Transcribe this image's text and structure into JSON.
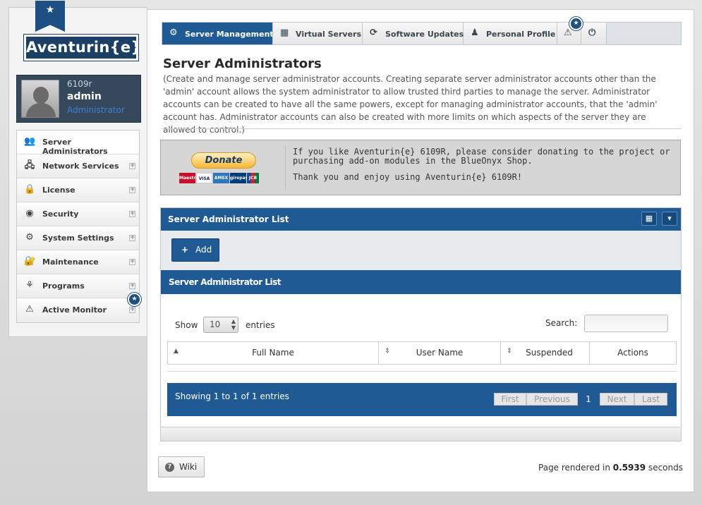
{
  "brand": {
    "name": "Aventurin{e}"
  },
  "user": {
    "host": "6109r",
    "name": "admin",
    "role": "Administrator"
  },
  "sidebar": {
    "items": [
      {
        "label": "Server Administrators",
        "icon": "users-icon",
        "glyph": "👥"
      },
      {
        "label": "Network Services",
        "icon": "network-icon",
        "glyph": "🖧"
      },
      {
        "label": "License",
        "icon": "lock-icon",
        "glyph": "🔒"
      },
      {
        "label": "Security",
        "icon": "eye-icon",
        "glyph": "◉"
      },
      {
        "label": "System Settings",
        "icon": "gear-icon",
        "glyph": "⚙"
      },
      {
        "label": "Maintenance",
        "icon": "wrench-lock-icon",
        "glyph": "🔐"
      },
      {
        "label": "Programs",
        "icon": "robot-icon",
        "glyph": "⚘"
      },
      {
        "label": "Active Monitor",
        "icon": "warning-icon",
        "glyph": "⚠"
      }
    ]
  },
  "tabs": [
    {
      "label": "Server Management",
      "icon": "gear-icon"
    },
    {
      "label": "Virtual Servers",
      "icon": "grid-icon"
    },
    {
      "label": "Software Updates",
      "icon": "refresh-icon"
    },
    {
      "label": "Personal Profile",
      "icon": "person-icon"
    }
  ],
  "page": {
    "title": "Server Administrators",
    "description": "(Create and manage server administrator accounts. Creating separate server administrator accounts other than the 'admin' account allows the system administrator to allow trusted third parties to manage the server. Administrator accounts can be created to have all the same powers, except for managing administrator accounts, that the 'admin' account has. Administrator accounts can also be created with more limits on which aspects of the server they are allowed to control.)"
  },
  "donate": {
    "button": "Donate",
    "cards": [
      "Maestro",
      "VISA",
      "AMEX",
      "giropay",
      "JCB"
    ],
    "text1": "If you like Aventurin{e} 6109R, please consider donating to the project or purchasing add-on modules in the BlueOnyx Shop.",
    "text2": "Thank you and enjoy using Aventurin{e} 6109R!"
  },
  "list": {
    "title": "Server Administrator List",
    "add_label": "Add",
    "subtitle": "Server Administrator List",
    "show_label": "Show",
    "entries_value": "10",
    "entries_label": "entries",
    "search_label": "Search:",
    "search_value": "",
    "columns": [
      "Full Name",
      "User Name",
      "Suspended",
      "Actions"
    ],
    "info": "Showing 1 to 1 of 1 entries",
    "pager": {
      "first": "First",
      "previous": "Previous",
      "current": "1",
      "next": "Next",
      "last": "Last"
    }
  },
  "footer": {
    "wiki_label": "Wiki",
    "render_prefix": "Page rendered in",
    "render_time": "0.5939",
    "render_suffix": "seconds"
  },
  "colors": {
    "primary": "#1f5a94",
    "dark": "#35485c"
  }
}
